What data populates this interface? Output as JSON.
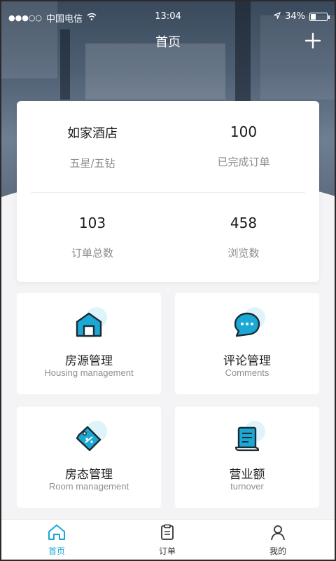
{
  "status_bar": {
    "signal": "●●●○○",
    "carrier": "中国电信",
    "time": "13:04",
    "battery": "34%",
    "battery_level": 0.34
  },
  "header": {
    "title": "首页",
    "add_icon": "plus-icon"
  },
  "stats": [
    {
      "value": "如家酒店",
      "label": "五星/五钻"
    },
    {
      "value": "100",
      "label": "已完成订单"
    },
    {
      "value": "103",
      "label": "订单总数"
    },
    {
      "value": "458",
      "label": "浏览数"
    }
  ],
  "features": [
    {
      "title": "房源管理",
      "subtitle": "Housing management",
      "icon": "house-icon"
    },
    {
      "title": "评论管理",
      "subtitle": "Comments",
      "icon": "chat-bubble-icon"
    },
    {
      "title": "房态管理",
      "subtitle": "Room management",
      "icon": "tag-icon"
    },
    {
      "title": "营业额",
      "subtitle": "turnover",
      "icon": "receipt-icon"
    }
  ],
  "tabs": [
    {
      "label": "首页",
      "icon": "home-icon",
      "active": true
    },
    {
      "label": "订单",
      "icon": "clipboard-icon",
      "active": false
    },
    {
      "label": "我的",
      "icon": "user-icon",
      "active": false
    }
  ],
  "colors": {
    "accent": "#1aa9d4",
    "icon_dark": "#1e2b35",
    "text_muted": "#8c8c8c"
  }
}
